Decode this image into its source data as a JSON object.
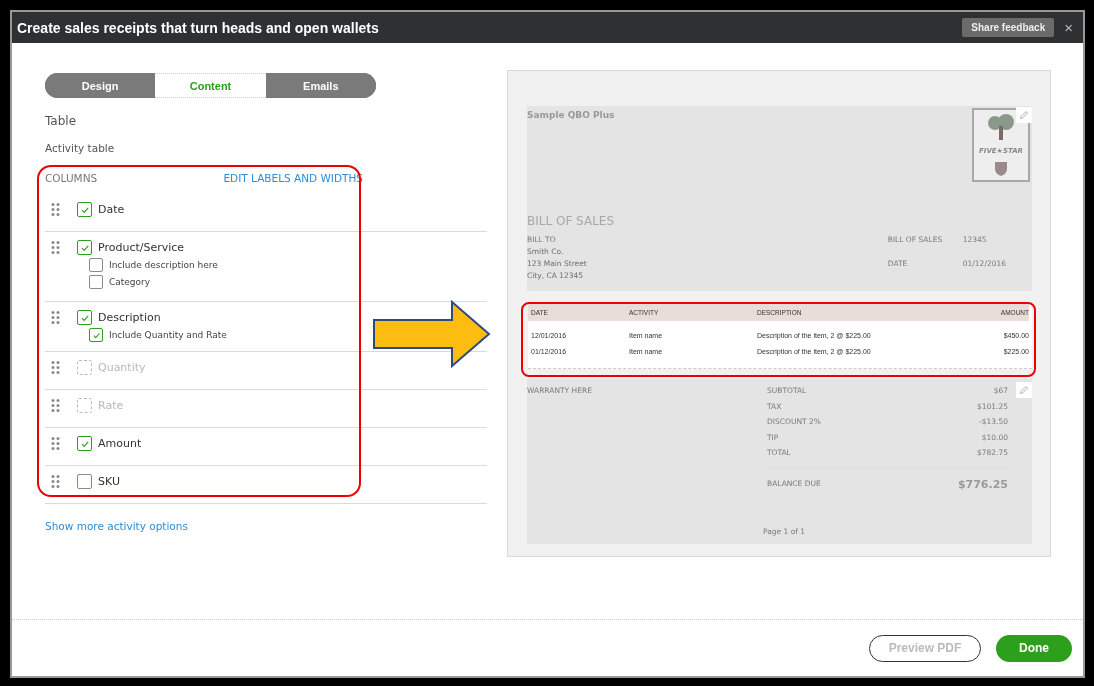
{
  "window": {
    "title": "Create sales receipts that turn heads and open wallets",
    "feedback_button": "Share feedback",
    "close": "×"
  },
  "tabs": [
    {
      "label": "Design",
      "selected": false
    },
    {
      "label": "Content",
      "selected": true
    },
    {
      "label": "Emails",
      "selected": false
    }
  ],
  "section_title": "Table",
  "subsection_title": "Activity table",
  "columns": {
    "heading": "COLUMNS",
    "edit_link": "EDIT LABELS AND WIDTHS",
    "rows": [
      {
        "label": "Date",
        "checked": true,
        "disabled": false
      },
      {
        "label": "Product/Service",
        "checked": true,
        "disabled": false,
        "children": [
          {
            "label": "Include description here",
            "checked": false
          },
          {
            "label": "Category",
            "checked": false
          }
        ]
      },
      {
        "label": "Description",
        "checked": true,
        "disabled": false,
        "children": [
          {
            "label": "Include Quantity and Rate",
            "checked": true
          }
        ]
      },
      {
        "label": "Quantity",
        "checked": false,
        "disabled": true
      },
      {
        "label": "Rate",
        "checked": false,
        "disabled": true
      },
      {
        "label": "Amount",
        "checked": true,
        "disabled": false
      },
      {
        "label": "SKU",
        "checked": false,
        "disabled": false
      }
    ]
  },
  "more_link": "Show more activity options",
  "preview": {
    "company": "Sample QBO Plus",
    "logo_text": "FIVE★STAR",
    "doc_title": "BILL OF SALES",
    "bill_to": [
      "BILL TO",
      "Smith Co.",
      "123 Main Street",
      "City, CA 12345"
    ],
    "meta": [
      {
        "label": "BILL OF SALES",
        "value": "12345"
      },
      {
        "label": "DATE",
        "value": "01/12/2016"
      }
    ],
    "table": {
      "columns": [
        "DATE",
        "ACTIVITY",
        "DESCRIPTION",
        "AMOUNT"
      ],
      "rows": [
        [
          "12/01/2016",
          "Item name",
          "Description of the item, 2 @ $225.00",
          "$450.00"
        ],
        [
          "01/12/2016",
          "Item name",
          "Description of the item, 2 @ $225.00",
          "$225.00"
        ]
      ]
    },
    "warranty": "WARRANTY HERE",
    "totals": [
      {
        "label": "SUBTOTAL",
        "value": "$67"
      },
      {
        "label": "TAX",
        "value": "$101.25"
      },
      {
        "label": "DISCOUNT 2%",
        "value": "-$13.50"
      },
      {
        "label": "TIP",
        "value": "$10.00"
      },
      {
        "label": "TOTAL",
        "value": "$782.75"
      }
    ],
    "balance": {
      "label": "BALANCE DUE",
      "value": "$776.25"
    },
    "page": "Page 1 of 1"
  },
  "footer": {
    "preview_button": "Preview PDF",
    "done_button": "Done"
  }
}
